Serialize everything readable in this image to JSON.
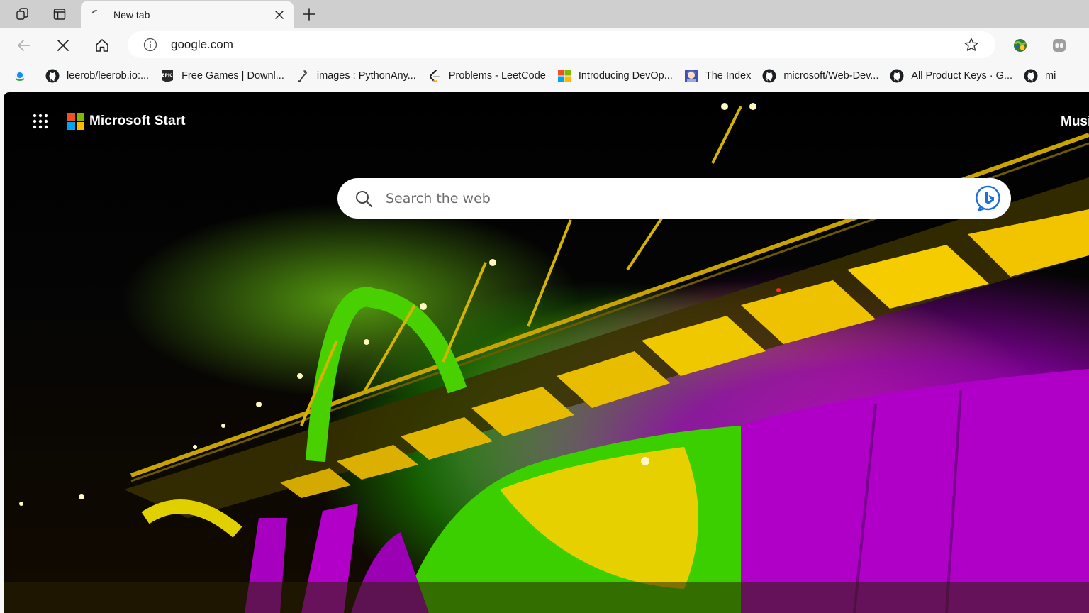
{
  "browser": {
    "tab": {
      "title": "New tab",
      "loading": true
    },
    "address_bar": {
      "url": "google.com"
    },
    "icons": {
      "workspaces": "workspaces-icon",
      "vertical_tabs": "vertical-tabs-icon",
      "close_tab": "close-icon",
      "new_tab": "plus-icon",
      "back": "back-arrow-icon",
      "stop": "stop-loading-icon",
      "home": "home-icon",
      "site_info": "info-icon",
      "favorite": "star-icon",
      "extension": "extension-globe-icon",
      "profile": "profile-icon"
    }
  },
  "bookmarks": [
    {
      "label": "",
      "icon": "edge-favicon"
    },
    {
      "label": "leerob/leerob.io:...",
      "icon": "github-icon"
    },
    {
      "label": "Free Games | Downl...",
      "icon": "epic-games-icon"
    },
    {
      "label": "images : PythonAny...",
      "icon": "pythonanywhere-icon"
    },
    {
      "label": "Problems - LeetCode",
      "icon": "leetcode-icon"
    },
    {
      "label": "Introducing DevOp...",
      "icon": "microsoft-icon"
    },
    {
      "label": "The Index",
      "icon": "anime-avatar-icon"
    },
    {
      "label": "microsoft/Web-Dev...",
      "icon": "github-icon"
    },
    {
      "label": "All Product Keys · G...",
      "icon": "github-icon"
    },
    {
      "label": "mi",
      "icon": "github-icon"
    }
  ],
  "newtab_page": {
    "brand": "Microsoft Start",
    "right_text": "Musi",
    "search": {
      "placeholder": "Search the web"
    },
    "colors": {
      "ms_red": "#f25022",
      "ms_green": "#7fba00",
      "ms_blue": "#00a4ef",
      "ms_yellow": "#ffb900",
      "bing_blue": "#1b6fd8"
    }
  }
}
